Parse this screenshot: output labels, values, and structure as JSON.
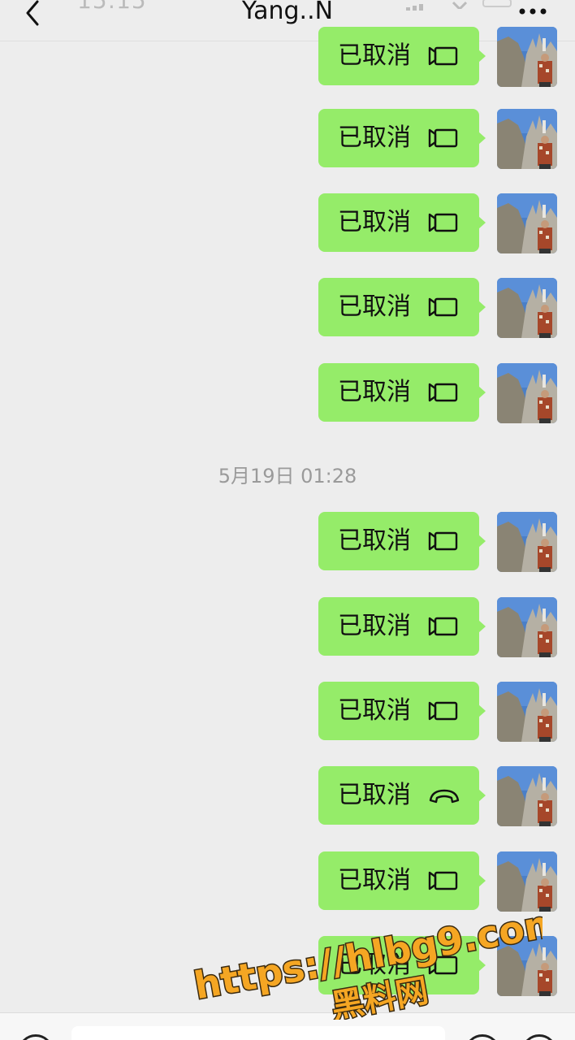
{
  "status_bar": {
    "time": "15:15"
  },
  "header": {
    "title": "Yang..N",
    "back_icon": "chevron-left-icon",
    "more_icon": "ellipsis-icon"
  },
  "messages": [
    {
      "text": "已取消",
      "call_type": "video"
    },
    {
      "text": "已取消",
      "call_type": "video"
    },
    {
      "text": "已取消",
      "call_type": "video"
    },
    {
      "text": "已取消",
      "call_type": "video"
    },
    {
      "text": "已取消",
      "call_type": "video"
    },
    {
      "divider": "5月19日 01:28"
    },
    {
      "text": "已取消",
      "call_type": "video"
    },
    {
      "text": "已取消",
      "call_type": "video"
    },
    {
      "text": "已取消",
      "call_type": "video"
    },
    {
      "text": "已取消",
      "call_type": "voice"
    },
    {
      "text": "已取消",
      "call_type": "video"
    },
    {
      "text": "已取消",
      "call_type": "video"
    }
  ],
  "watermark": {
    "line1": "https://hlbg9.com",
    "line2": "黑料网"
  },
  "colors": {
    "bubble": "#95ec69",
    "background": "#ededed"
  }
}
